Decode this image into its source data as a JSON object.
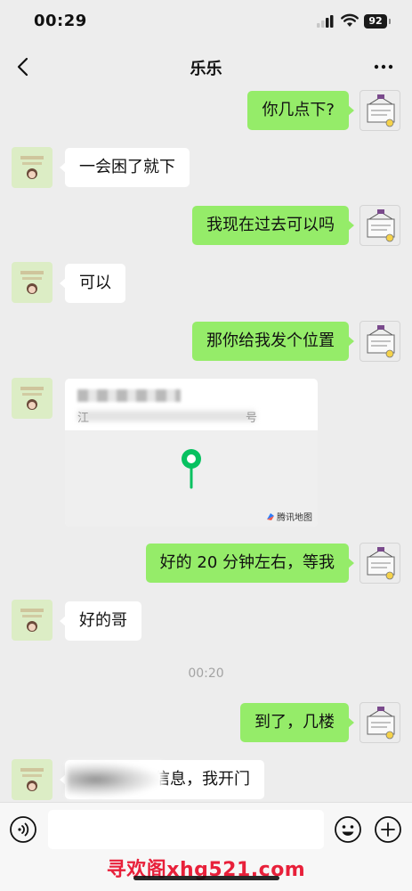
{
  "status_bar": {
    "time": "00:29",
    "battery": "92"
  },
  "nav": {
    "title": "乐乐"
  },
  "messages": [
    {
      "side": "right",
      "text": "你几点下?"
    },
    {
      "side": "left",
      "text": "一会困了就下"
    },
    {
      "side": "right",
      "text": "我现在过去可以吗"
    },
    {
      "side": "left",
      "text": "可以"
    },
    {
      "side": "right",
      "text": "那你给我发个位置"
    },
    {
      "side": "left",
      "type": "location",
      "address_prefix": "江",
      "address_suffix": "号",
      "map_brand": "腾讯地图"
    },
    {
      "side": "right",
      "text": "好的 20 分钟左右，等我"
    },
    {
      "side": "left",
      "text": "好的哥"
    },
    {
      "side": "right",
      "text": "到了，几楼"
    },
    {
      "side": "left",
      "text": "信息，我开门"
    }
  ],
  "time_divider": "00:20",
  "input": {
    "placeholder": ""
  },
  "watermark": "寻欢阁xhg521.com",
  "colors": {
    "sent_bubble": "#95ec69",
    "received_bubble": "#ffffff",
    "background": "#ededed",
    "accent_pin": "#07c160"
  },
  "icons": [
    "back-icon",
    "more-icon",
    "voice-icon",
    "emoji-icon",
    "plus-icon",
    "location-pin-icon"
  ]
}
